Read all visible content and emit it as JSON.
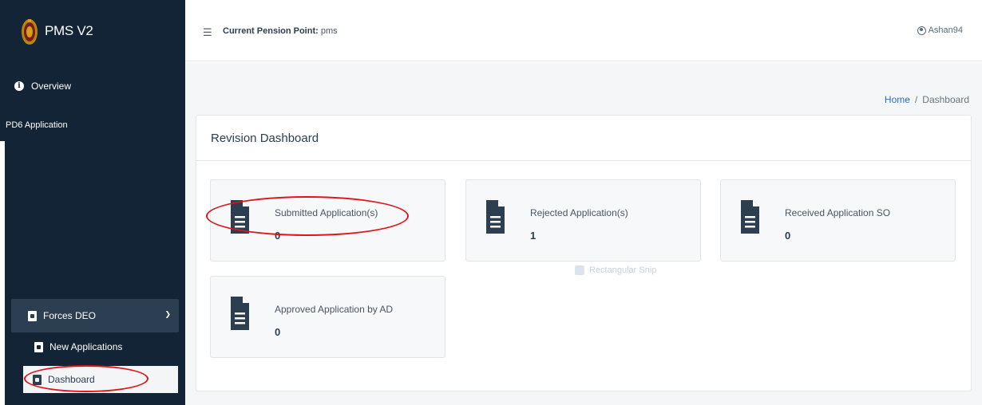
{
  "app": {
    "title": "PMS V2"
  },
  "sidebar": {
    "overview_label": "Overview",
    "pd6_label": "PD6 Application",
    "forces_label": "Forces DEO",
    "new_applications_label": "New Applications",
    "dashboard_label": "Dashboard"
  },
  "topbar": {
    "pension_label": "Current Pension Point:",
    "pension_value": "pms",
    "username": "Ashan94"
  },
  "breadcrumb": {
    "home": "Home",
    "separator": "/",
    "current": "Dashboard"
  },
  "dashboard": {
    "title": "Revision Dashboard",
    "cards": [
      {
        "label": "Submitted Application(s)",
        "value": "0"
      },
      {
        "label": "Rejected Application(s)",
        "value": "1"
      },
      {
        "label": "Received Application SO",
        "value": "0"
      },
      {
        "label": "Approved Application by AD",
        "value": "0"
      }
    ]
  },
  "watermark": {
    "text": "Rectangular Snip"
  },
  "colors": {
    "sidebar_bg": "#132437",
    "accent_link": "#2a6fc1",
    "annotation": "#e0141c"
  },
  "icons": [
    "info-icon",
    "document-icon",
    "menu-icon",
    "user-icon",
    "chevron-down-icon"
  ]
}
